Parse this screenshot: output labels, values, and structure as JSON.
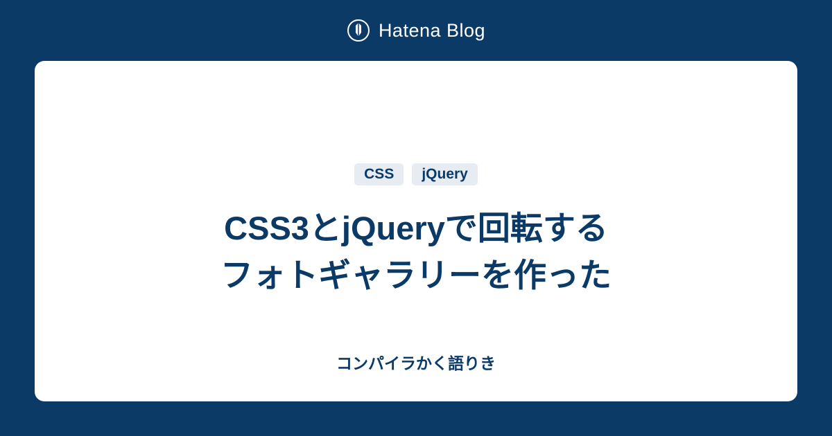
{
  "header": {
    "brand": "Hatena Blog"
  },
  "card": {
    "tags": [
      "CSS",
      "jQuery"
    ],
    "title": "CSS3とjQueryで回転する\nフォトギャラリーを作った",
    "subtitle": "コンパイラかく語りき"
  },
  "colors": {
    "background": "#0c3a67",
    "card_bg": "#ffffff",
    "tag_bg": "#e6ecf2",
    "text_primary": "#0c3a67"
  }
}
